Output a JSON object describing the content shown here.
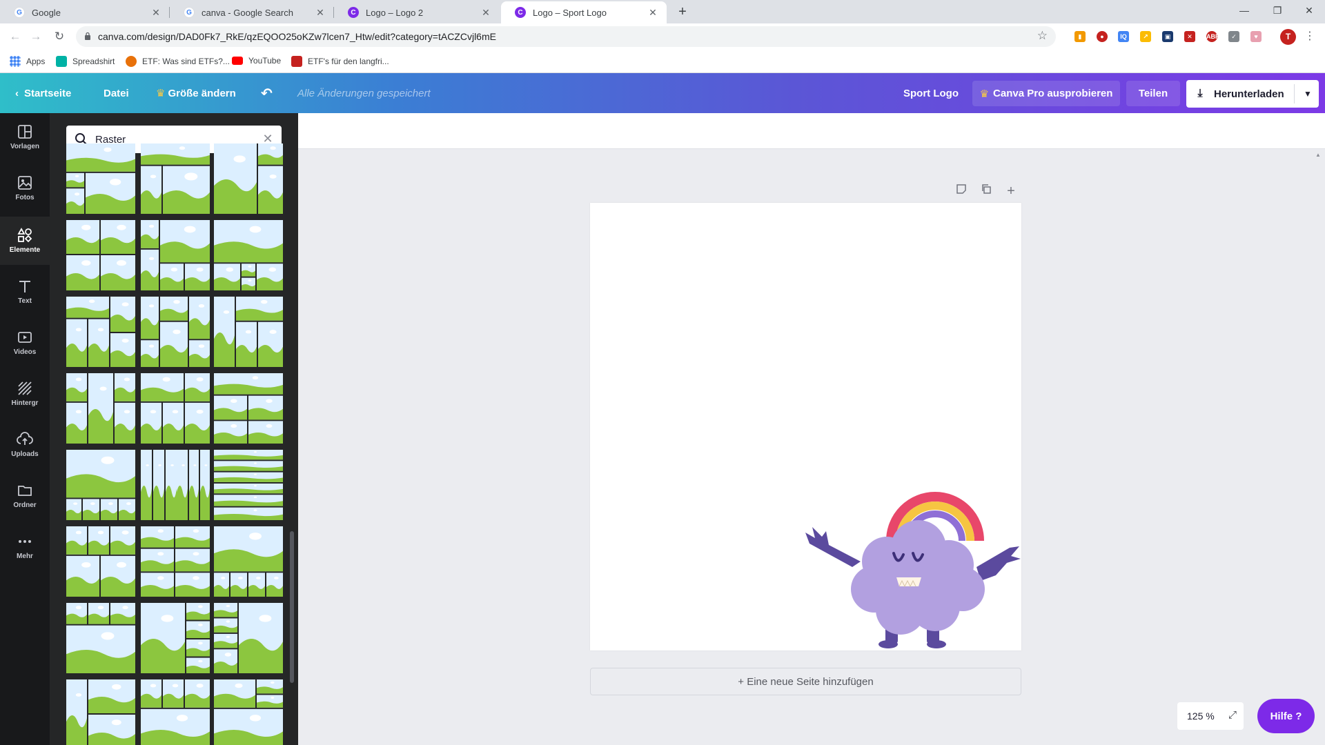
{
  "browser": {
    "tabs": [
      {
        "title": "Google",
        "favicon": "google-icon",
        "active": false
      },
      {
        "title": "canva - Google Search",
        "favicon": "google-icon",
        "active": false
      },
      {
        "title": "Logo – Logo 2",
        "favicon": "canva-icon",
        "active": false
      },
      {
        "title": "Logo – Sport Logo",
        "favicon": "canva-icon",
        "active": true
      }
    ],
    "new_tab": "+",
    "url": "canva.com/design/DAD0Fk7_RkE/qzEQOO25oKZw7lcen7_Htw/edit?category=tACZCvjl6mE",
    "bookmarks": [
      {
        "label": "Apps",
        "icon": "apps-grid-icon",
        "color": "#4285f4"
      },
      {
        "label": "Spreadshirt",
        "icon": "spreadshirt-icon",
        "color": "#00b2a5"
      },
      {
        "label": "ETF: Was sind ETFs?...",
        "icon": "etf-icon",
        "color": "#e8710a"
      },
      {
        "label": "YouTube",
        "icon": "youtube-icon",
        "color": "#ff0000"
      },
      {
        "label": "ETF's für den langfri...",
        "icon": "etf-logo-icon",
        "color": "#c5221f"
      }
    ],
    "profile_initial": "T"
  },
  "header": {
    "home_label": "Startseite",
    "file_label": "Datei",
    "resize_label": "Größe ändern",
    "saved_status": "Alle Änderungen gespeichert",
    "design_title": "Sport Logo",
    "pro_label": "Canva Pro ausprobieren",
    "share_label": "Teilen",
    "download_label": "Herunterladen"
  },
  "rail": {
    "items": [
      {
        "label": "Vorlagen",
        "icon": "templates-icon"
      },
      {
        "label": "Fotos",
        "icon": "photos-icon"
      },
      {
        "label": "Elemente",
        "icon": "elements-icon",
        "active": true
      },
      {
        "label": "Text",
        "icon": "text-icon"
      },
      {
        "label": "Videos",
        "icon": "videos-icon"
      },
      {
        "label": "Hintergr",
        "icon": "background-icon"
      },
      {
        "label": "Uploads",
        "icon": "uploads-icon"
      },
      {
        "label": "Ordner",
        "icon": "folder-icon"
      },
      {
        "label": "Mehr",
        "icon": "more-icon"
      }
    ]
  },
  "panel": {
    "search_value": "Raster",
    "search_placeholder": "Raster"
  },
  "editor": {
    "add_page_label": "+ Eine neue Seite hinzufügen",
    "zoom_level": "125 %",
    "help_label": "Hilfe ?"
  },
  "colors": {
    "accent": "#7d2ae8",
    "panel_bg": "#252627",
    "rail_bg": "#18191b",
    "sky": "#dcefff",
    "grass": "#8cc63f"
  }
}
